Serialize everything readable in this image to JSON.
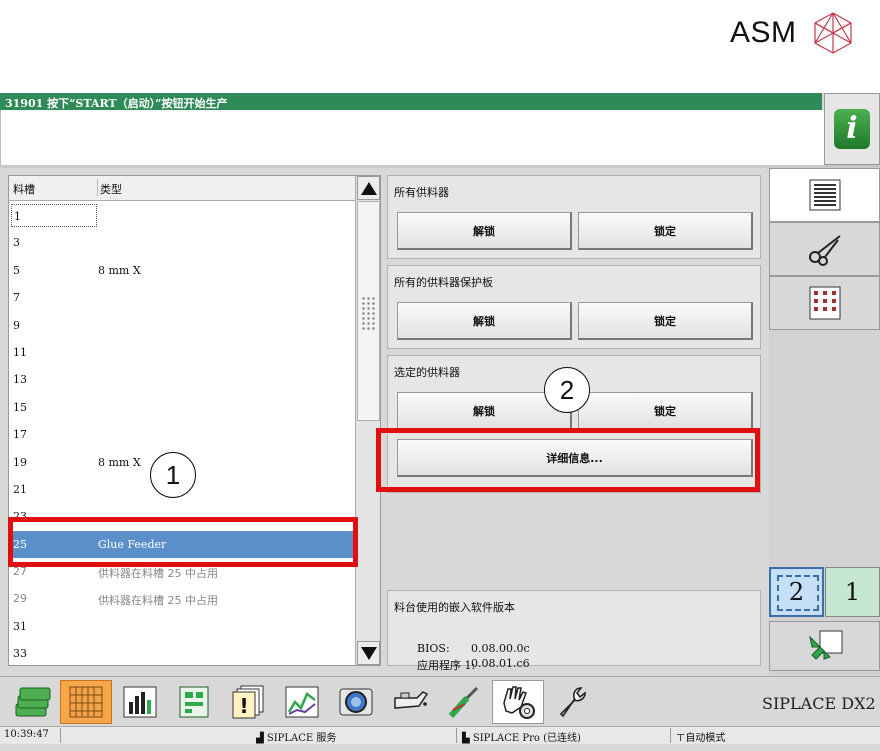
{
  "brand": {
    "logo_text": "ASM",
    "product": "SIPLACE DX2"
  },
  "status": {
    "message": "31901 按下“START（启动）”按钮开始生产"
  },
  "track_list": {
    "columns": {
      "slot": "料槽",
      "type": "类型"
    },
    "rows": [
      {
        "slot": "1",
        "type": ""
      },
      {
        "slot": "3",
        "type": ""
      },
      {
        "slot": "5",
        "type": "8 mm X"
      },
      {
        "slot": "7",
        "type": ""
      },
      {
        "slot": "9",
        "type": ""
      },
      {
        "slot": "11",
        "type": ""
      },
      {
        "slot": "13",
        "type": ""
      },
      {
        "slot": "15",
        "type": ""
      },
      {
        "slot": "17",
        "type": ""
      },
      {
        "slot": "19",
        "type": "8 mm X"
      },
      {
        "slot": "21",
        "type": ""
      },
      {
        "slot": "23",
        "type": ""
      },
      {
        "slot": "25",
        "type": "Glue Feeder"
      },
      {
        "slot": "27",
        "type": "供料器在料槽 25 中占用"
      },
      {
        "slot": "29",
        "type": "供料器在料槽 25 中占用"
      },
      {
        "slot": "31",
        "type": ""
      },
      {
        "slot": "33",
        "type": ""
      }
    ]
  },
  "panels": {
    "all_feeders": {
      "title": "所有供料器",
      "unlock": "解锁",
      "lock": "锁定"
    },
    "all_covers": {
      "title": "所有的供料器保护板",
      "unlock": "解锁",
      "lock": "锁定"
    },
    "selected_feeder": {
      "title": "选定的供料器",
      "unlock": "解锁",
      "lock": "锁定",
      "details": "详细信息..."
    },
    "firmware": {
      "title": "料台使用的嵌入软件版本",
      "bios_label": "BIOS:",
      "bios_value": "0.08.00.0c",
      "app_label": "应用程序 1:",
      "app_value": "0.08.01.c6"
    }
  },
  "annotations": {
    "one": "1",
    "two": "2"
  },
  "sidebar": {
    "page_2": "2",
    "page_1": "1"
  },
  "footer": {
    "time": "10:39:47",
    "service": "SIPLACE 服务",
    "connection": "SIPLACE Pro (已连线)",
    "mode": "自动模式"
  },
  "colors": {
    "status_bar": "#2e8b57",
    "selected_row": "#5b8fc9",
    "annotation": "#e01010",
    "active_tool": "#f7a74a"
  }
}
